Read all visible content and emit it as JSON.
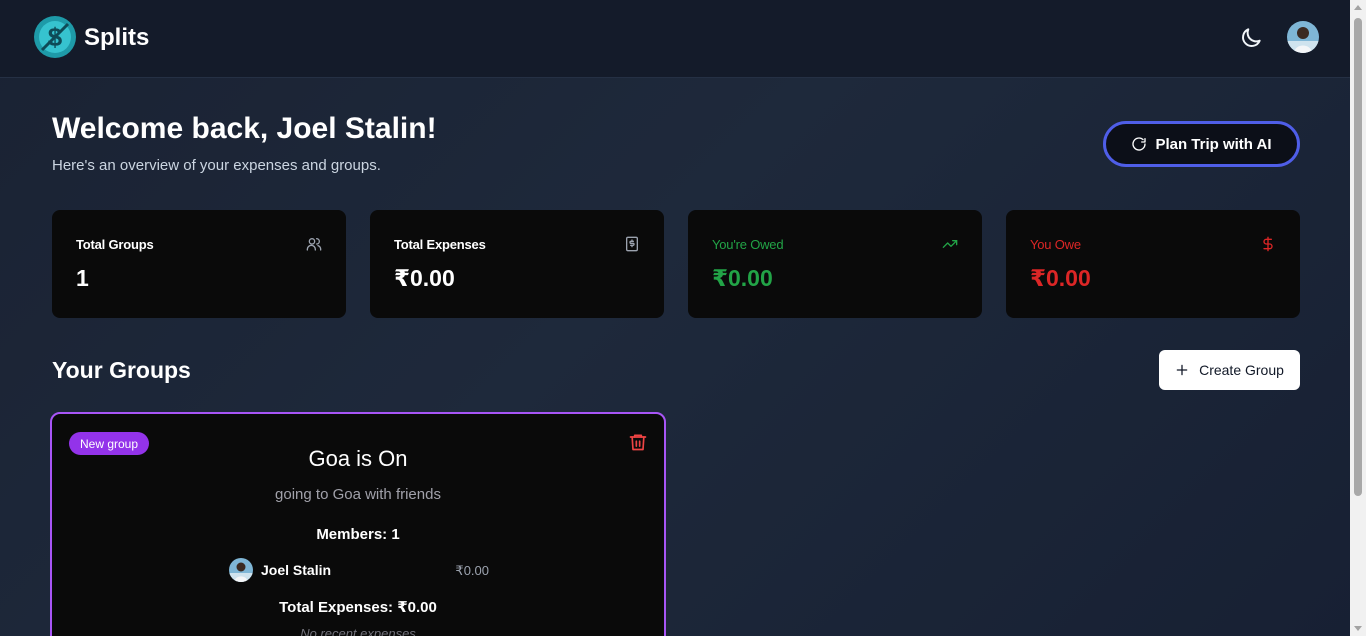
{
  "app": {
    "brand": "Splits"
  },
  "header": {
    "theme_icon": "moon-icon",
    "avatar_alt": "user-avatar"
  },
  "welcome": {
    "title": "Welcome back, Joel Stalin!",
    "subtitle": "Here's an overview of your expenses and groups.",
    "plan_button": "Plan Trip with AI"
  },
  "stats": [
    {
      "title": "Total Groups",
      "value": "1",
      "icon": "users-icon",
      "color": "#ffffff"
    },
    {
      "title": "Total Expenses",
      "value": "₹0.00",
      "icon": "receipt-icon",
      "color": "#ffffff"
    },
    {
      "title": "You're Owed",
      "value": "₹0.00",
      "icon": "trending-up-icon",
      "color": "#22a447"
    },
    {
      "title": "You Owe",
      "value": "₹0.00",
      "icon": "dollar-icon",
      "color": "#dc2626"
    }
  ],
  "groups_section": {
    "title": "Your Groups",
    "create_button": "Create Group"
  },
  "groups": [
    {
      "badge": "New group",
      "name": "Goa is On",
      "description": "going to Goa with friends",
      "members_label": "Members: 1",
      "members": [
        {
          "name": "Joel Stalin",
          "amount": "₹0.00"
        }
      ],
      "total_label": "Total Expenses: ₹0.00",
      "recent_label": "No recent expenses"
    }
  ],
  "colors": {
    "accent_border": "#4f5ee8",
    "group_border": "#a855f7",
    "badge": "#9333ea",
    "owed": "#22a447",
    "owe": "#dc2626"
  }
}
